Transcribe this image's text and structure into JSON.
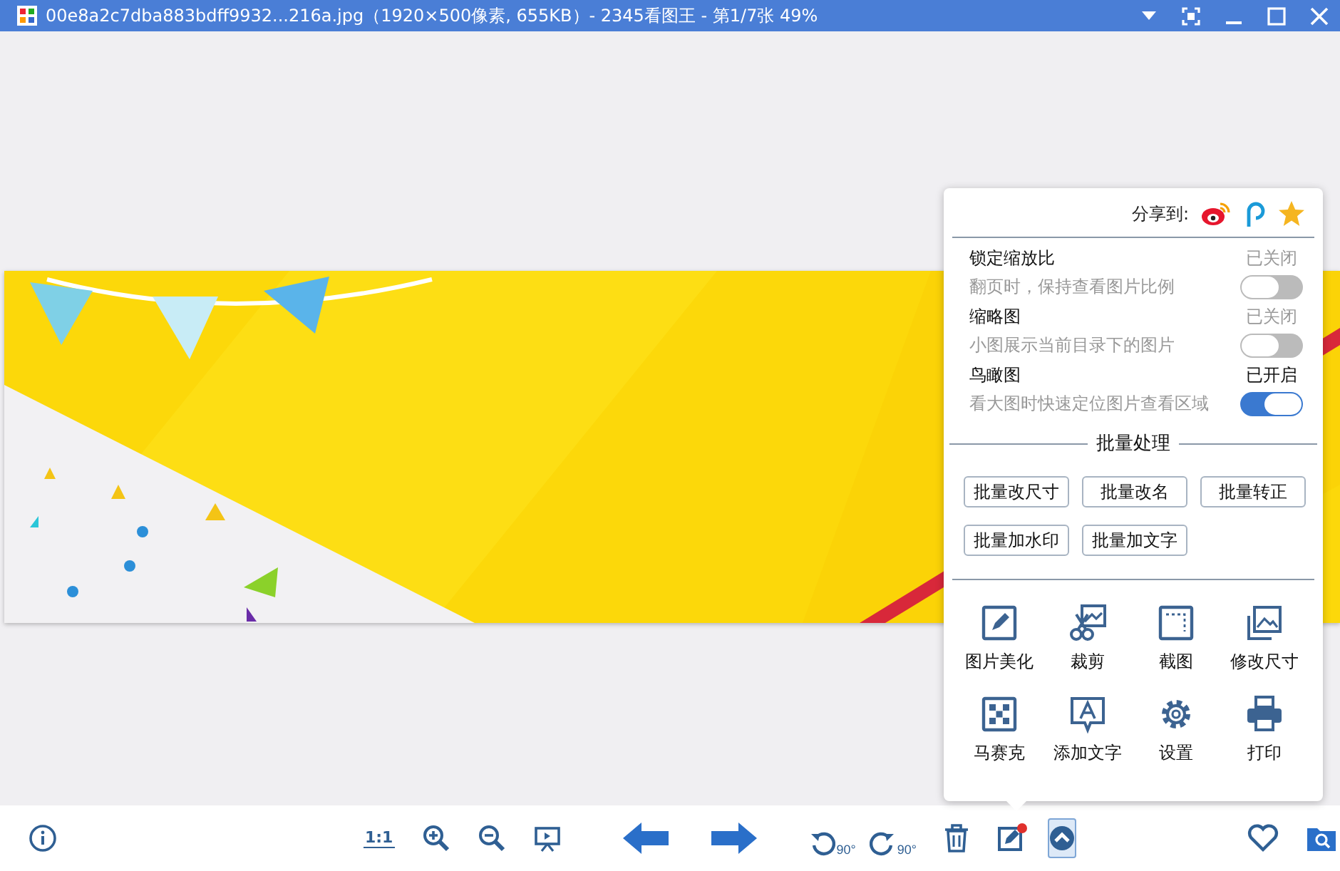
{
  "window": {
    "title": "00e8a2c7dba883bdff9932...216a.jpg（1920×500像素, 655KB）- 2345看图王 - 第1/7张 49%"
  },
  "panel": {
    "open": true,
    "share_label": "分享到:",
    "settings": [
      {
        "title": "锁定缩放比",
        "status": "已关闭",
        "description": "翻页时，保持查看图片比例",
        "on": false
      },
      {
        "title": "缩略图",
        "status": "已关闭",
        "description": "小图展示当前目录下的图片",
        "on": false
      },
      {
        "title": "鸟瞰图",
        "status": "已开启",
        "description": "看大图时快速定位图片查看区域",
        "on": true
      }
    ],
    "batch_title": "批量处理",
    "batch_buttons": [
      "批量改尺寸",
      "批量改名",
      "批量转正",
      "批量加水印",
      "批量加文字"
    ],
    "tools": [
      {
        "label": "图片美化",
        "kind": "pencil"
      },
      {
        "label": "裁剪",
        "kind": "scissors"
      },
      {
        "label": "截图",
        "kind": "frame"
      },
      {
        "label": "修改尺寸",
        "kind": "resize"
      },
      {
        "label": "马赛克",
        "kind": "mosaic"
      },
      {
        "label": "添加文字",
        "kind": "text"
      },
      {
        "label": "设置",
        "kind": "gear"
      },
      {
        "label": "打印",
        "kind": "printer"
      }
    ]
  },
  "toolbar": {
    "actual_size": "1:1",
    "rotate_left": "90°",
    "rotate_right": "90°"
  }
}
